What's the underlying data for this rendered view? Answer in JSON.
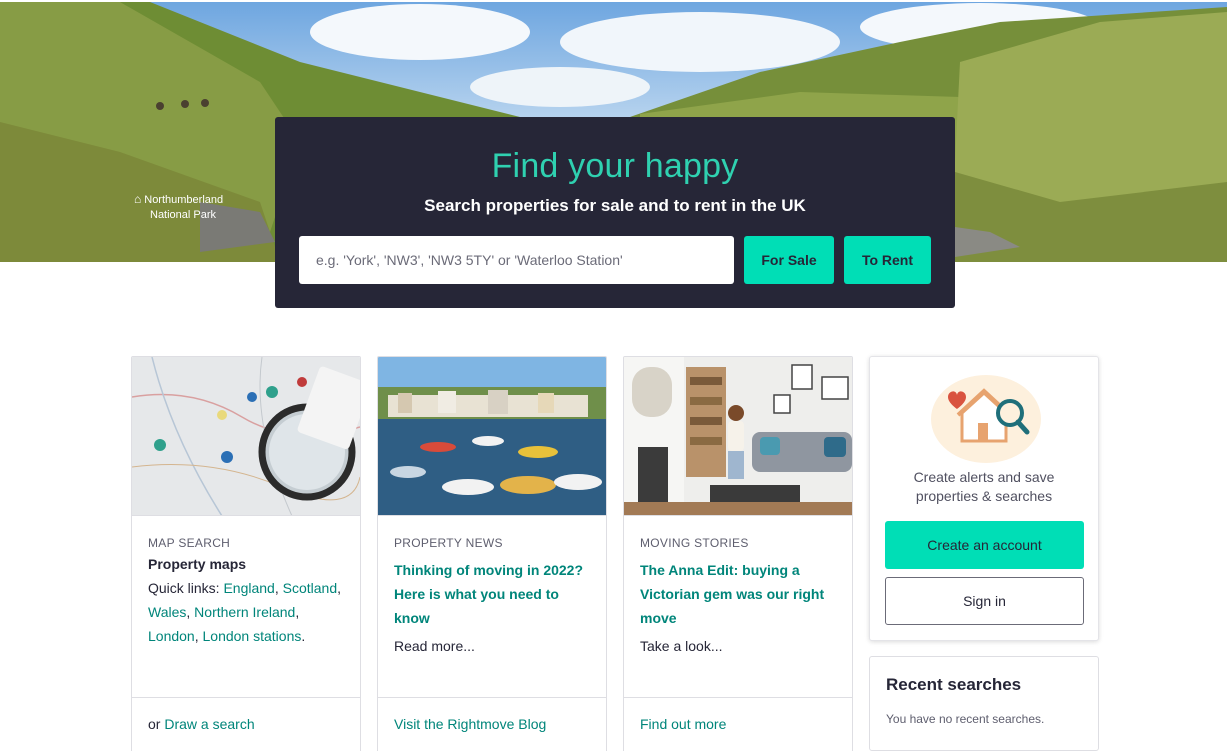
{
  "hero": {
    "park_logo_line1": "Northumberland",
    "park_logo_line2": "National Park",
    "title": "Find your happy",
    "subtitle": "Search properties for sale and to rent in the UK",
    "search_placeholder": "e.g. 'York', 'NW3', 'NW3 5TY' or 'Waterloo Station'",
    "for_sale_label": "For Sale",
    "to_rent_label": "To Rent"
  },
  "cards": [
    {
      "kicker": "MAP SEARCH",
      "title": "Property maps",
      "quick_links_prefix": "Quick links: ",
      "quick_links": [
        "England",
        "Scotland",
        "Wales",
        "Northern Ireland",
        "London",
        "London stations"
      ],
      "footer_prefix": "or ",
      "footer_link": "Draw a search"
    },
    {
      "kicker": "PROPERTY NEWS",
      "title": "Thinking of moving in 2022? Here is what you need to know",
      "text": "Read more...",
      "footer_link": "Visit the Rightmove Blog"
    },
    {
      "kicker": "MOVING STORIES",
      "title": "The Anna Edit: buying a Victorian gem was our right move",
      "text": "Take a look...",
      "footer_link": "Find out more"
    }
  ],
  "account": {
    "text_line1": "Create alerts and save",
    "text_line2": "properties & searches",
    "create_label": "Create an account",
    "signin_label": "Sign in"
  },
  "recent": {
    "title": "Recent searches",
    "empty": "You have no recent searches."
  },
  "colors": {
    "brand_dark": "#262637",
    "accent_green": "#00deb6",
    "title_green": "#2fd1b0",
    "link_teal": "#00857a"
  },
  "icons": [
    "home-outline-icon",
    "heart-icon",
    "house-magnifier-icon"
  ]
}
